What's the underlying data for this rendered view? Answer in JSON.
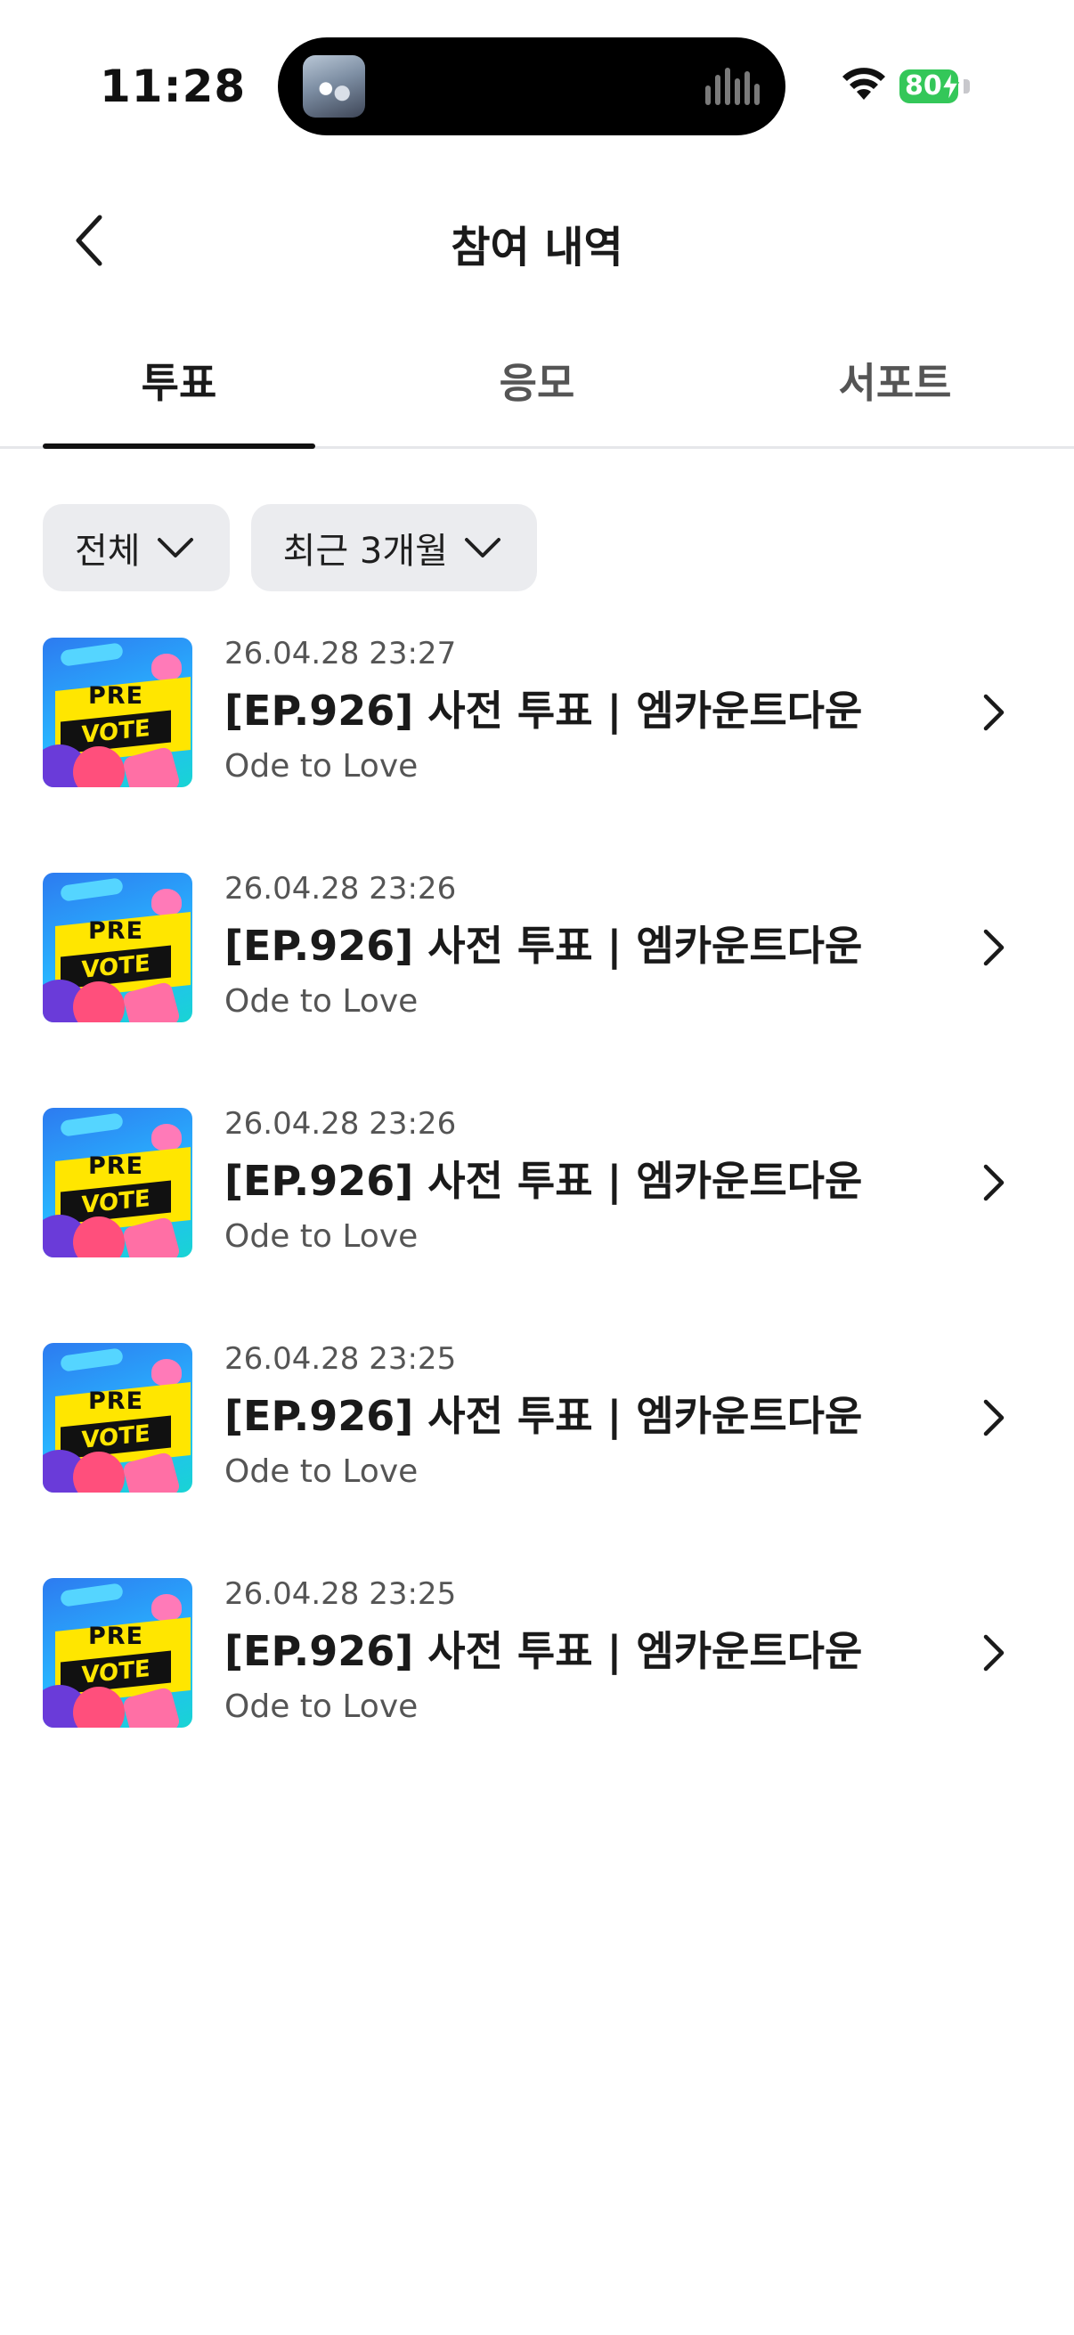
{
  "status_bar": {
    "time": "11:28",
    "battery": "80"
  },
  "header": {
    "title": "참여 내역"
  },
  "tabs": [
    {
      "label": "투표",
      "active": true
    },
    {
      "label": "응모",
      "active": false
    },
    {
      "label": "서포트",
      "active": false
    }
  ],
  "filters": [
    {
      "label": "전체"
    },
    {
      "label": "최근 3개월"
    }
  ],
  "thumbnail": {
    "top_text": "PRE",
    "bottom_text": "VOTE"
  },
  "items": [
    {
      "date": "26.04.28 23:27",
      "title": "[EP.926] 사전 투표 | 엠카운트다운",
      "subtitle": "Ode to Love"
    },
    {
      "date": "26.04.28 23:26",
      "title": "[EP.926] 사전 투표 | 엠카운트다운",
      "subtitle": "Ode to Love"
    },
    {
      "date": "26.04.28 23:26",
      "title": "[EP.926] 사전 투표 | 엠카운트다운",
      "subtitle": "Ode to Love"
    },
    {
      "date": "26.04.28 23:25",
      "title": "[EP.926] 사전 투표 | 엠카운트다운",
      "subtitle": "Ode to Love"
    },
    {
      "date": "26.04.28 23:25",
      "title": "[EP.926] 사전 투표 | 엠카운트다운",
      "subtitle": "Ode to Love"
    }
  ],
  "colors": {
    "battery": "#34c759",
    "chip_bg": "#ebecef",
    "tab_indicator": "#111111"
  }
}
